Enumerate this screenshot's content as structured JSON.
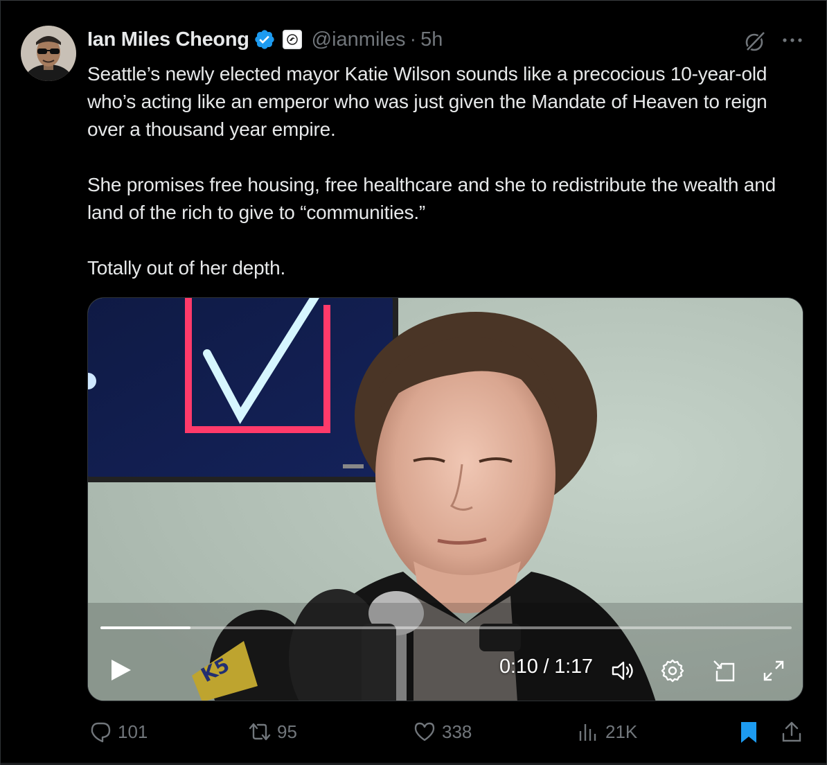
{
  "author": {
    "name": "Ian Miles Cheong",
    "handle": "@ianmiles",
    "separator": "·",
    "time": "5h",
    "verified_color": "#1d9bf0"
  },
  "post": {
    "paragraphs": [
      "Seattle’s newly elected mayor Katie Wilson sounds like a precocious 10-year-old who’s acting like an emperor who was just given the Mandate of Heaven to reign over a thousand year empire.",
      "She promises free housing, free healthcare and she to redistribute the wealth and land of the rich to give to “communities.”",
      "Totally out of her depth."
    ]
  },
  "video": {
    "current_time": "0:10",
    "duration": "1:17",
    "time_label": "0:10 / 1:17",
    "progress": 0.13,
    "mic_flag_text": "K5"
  },
  "icons": {
    "grok": "grok-icon",
    "more": "more-icon",
    "play": "play-icon",
    "volume": "volume-icon",
    "settings": "gear-icon",
    "pip": "picture-in-picture-icon",
    "fullscreen": "fullscreen-icon",
    "reply": "reply-icon",
    "repost": "repost-icon",
    "like": "heart-icon",
    "views": "views-icon",
    "bookmark": "bookmark-icon",
    "share": "share-icon"
  },
  "stats": {
    "replies": "101",
    "reposts": "95",
    "likes": "338",
    "views": "21K"
  },
  "colors": {
    "background": "#000000",
    "text": "#e7e9ea",
    "muted": "#71767b",
    "accent": "#1d9bf0"
  }
}
